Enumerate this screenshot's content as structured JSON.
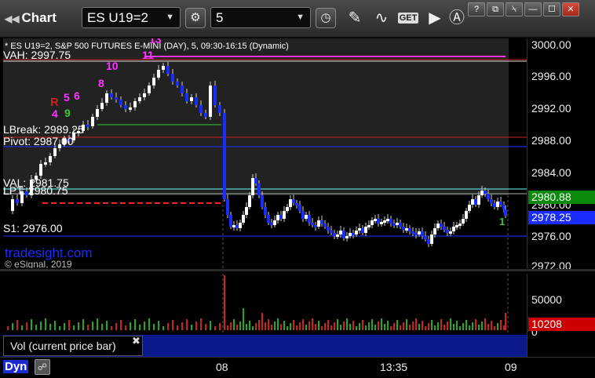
{
  "toolbar": {
    "title": "Chart",
    "symbol": "ES U19=2",
    "interval": "5",
    "get_label": "GET"
  },
  "chart": {
    "header": "* ES U19=2, S&P 500 FUTURES E-MINI (DAY), 5, 09:30-16:15 (Dynamic)",
    "watermark": "tradesight.com",
    "copyright": "© eSignal, 2019",
    "vol_pane_label": "Vol (current price bar)",
    "dyn_label": "Dyn"
  },
  "levels": {
    "vah": "VAH: 2997.75",
    "lbreak": "LBreak: 2989.25",
    "pivot": "Pivot: 2987.00",
    "val": "VAL: 2981.75",
    "lpt": "LPT: 2980.75",
    "s1": "S1: 2976.00"
  },
  "price_axis": {
    "ticks": [
      "3000.00",
      "2996.00",
      "2992.00",
      "2988.00",
      "2984.00",
      "2980.00",
      "2976.00",
      "2972.00"
    ],
    "tag_green": "2980.88",
    "tag_blue": "2978.25"
  },
  "vol_axis": {
    "ticks": [
      "50000",
      "0"
    ],
    "tag_red": "10208"
  },
  "time_axis": {
    "ticks": [
      "08",
      "13:35",
      "09"
    ]
  },
  "markers": [
    "4",
    "5",
    "6",
    "8",
    "9",
    "10",
    "11",
    "13",
    "R",
    "1"
  ],
  "colors": {
    "up_bar": "#ffffff",
    "down_bar": "#1a2cff",
    "vah_line": "#ff33ff",
    "pivot_line": "#cc2222",
    "val_line": "#66ffff",
    "s1_line": "#2233ff",
    "lbreak_line": "#33cc33",
    "tag_green": "#0a8a0a",
    "tag_blue": "#1a2cff",
    "tag_red": "#cc0000"
  }
}
